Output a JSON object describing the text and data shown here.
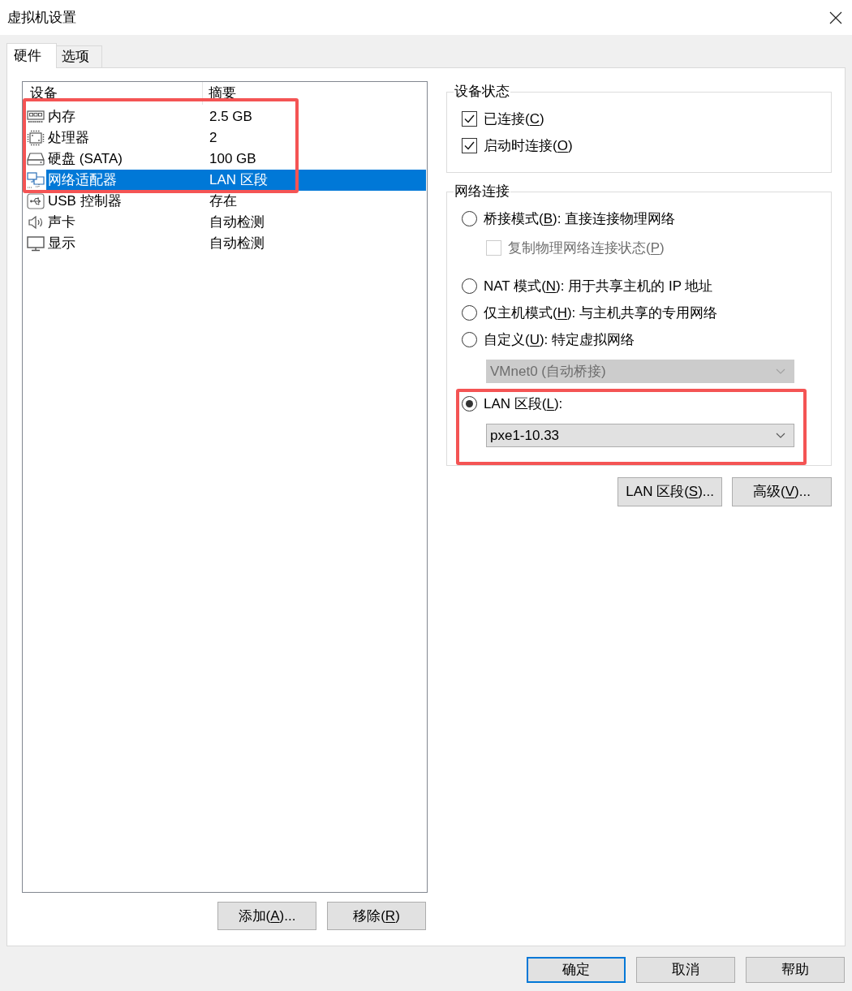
{
  "window": {
    "title": "虚拟机设置"
  },
  "tabs": [
    {
      "label": "硬件",
      "selected": true
    },
    {
      "label": "选项",
      "selected": false
    }
  ],
  "device_table": {
    "columns": [
      "设备",
      "摘要"
    ],
    "rows": [
      {
        "kind": "memory",
        "device": "内存",
        "summary": "2.5 GB",
        "selected": false,
        "annotated": true
      },
      {
        "kind": "processor",
        "device": "处理器",
        "summary": "2",
        "selected": false,
        "annotated": true
      },
      {
        "kind": "hard-disk",
        "device": "硬盘 (SATA)",
        "summary": "100 GB",
        "selected": false,
        "annotated": true
      },
      {
        "kind": "network",
        "device": "网络适配器",
        "summary": "LAN 区段",
        "selected": true,
        "annotated": true
      },
      {
        "kind": "usb",
        "device": "USB 控制器",
        "summary": "存在",
        "selected": false,
        "annotated": false
      },
      {
        "kind": "sound",
        "device": "声卡",
        "summary": "自动检测",
        "selected": false,
        "annotated": false
      },
      {
        "kind": "display",
        "device": "显示",
        "summary": "自动检测",
        "selected": false,
        "annotated": false
      }
    ]
  },
  "device_buttons": [
    {
      "label": {
        "before": "添加(",
        "key": "A",
        "after": ")..."
      }
    },
    {
      "label": {
        "before": "移除(",
        "key": "R",
        "after": ")"
      }
    }
  ],
  "device_status": {
    "title": "设备状态",
    "options": [
      {
        "label": {
          "before": "已连接(",
          "key": "C",
          "after": ")"
        },
        "checked": true
      },
      {
        "label": {
          "before": "启动时连接(",
          "key": "O",
          "after": ")"
        },
        "checked": true
      }
    ]
  },
  "network_connection": {
    "title": "网络连接",
    "options": [
      {
        "label": {
          "before": "桥接模式(",
          "key": "B",
          "after": "): 直接连接物理网络"
        },
        "selected": false,
        "annotated": false,
        "sub": {
          "kind": "checkbox",
          "label": {
            "before": "复制物理网络连接状态(",
            "key": "P",
            "after": ")"
          },
          "checked": false,
          "disabled": true
        }
      },
      {
        "label": {
          "before": "NAT 模式(",
          "key": "N",
          "after": "): 用于共享主机的 IP 地址"
        },
        "selected": false,
        "annotated": false
      },
      {
        "label": {
          "before": "仅主机模式(",
          "key": "H",
          "after": "): 与主机共享的专用网络"
        },
        "selected": false,
        "annotated": false
      },
      {
        "label": {
          "before": "自定义(",
          "key": "U",
          "after": "): 特定虚拟网络"
        },
        "selected": false,
        "annotated": false,
        "sub": {
          "kind": "dropdown",
          "value": "VMnet0 (自动桥接)",
          "disabled": true
        }
      },
      {
        "label": {
          "before": "LAN 区段(",
          "key": "L",
          "after": "):"
        },
        "selected": true,
        "annotated": true,
        "sub": {
          "kind": "dropdown",
          "value": "pxe1-10.33",
          "disabled": false
        }
      }
    ]
  },
  "network_buttons": [
    {
      "label": {
        "before": "LAN 区段(",
        "key": "S",
        "after": ")..."
      }
    },
    {
      "label": {
        "before": "高级(",
        "key": "V",
        "after": ")..."
      }
    }
  ],
  "dialog_buttons": [
    {
      "label": "确定",
      "default": true
    },
    {
      "label": "取消",
      "default": false
    },
    {
      "label": "帮助",
      "default": false
    }
  ]
}
